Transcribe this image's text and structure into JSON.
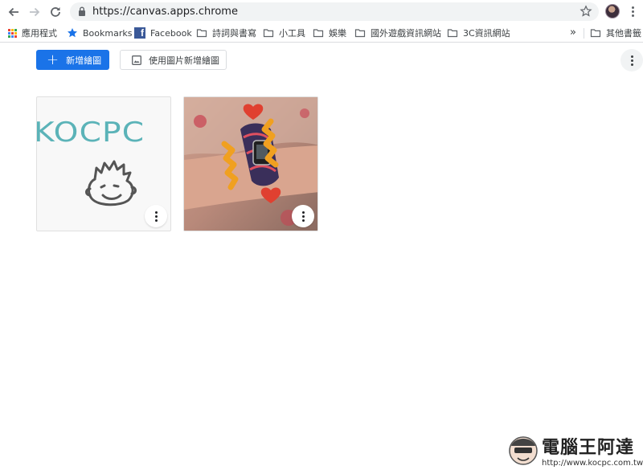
{
  "browser": {
    "url": "https://canvas.apps.chrome",
    "bookmarks": [
      {
        "label": "應用程式",
        "icon": "apps-grid-icon"
      },
      {
        "label": "Bookmarks",
        "icon": "star-icon"
      },
      {
        "label": "Facebook",
        "icon": "facebook-icon"
      },
      {
        "label": "詩詞與書寫",
        "icon": "folder-icon"
      },
      {
        "label": "小工具",
        "icon": "folder-icon"
      },
      {
        "label": "娛樂",
        "icon": "folder-icon"
      },
      {
        "label": "國外遊戲資訊網站",
        "icon": "folder-icon"
      },
      {
        "label": "3C資訊網站",
        "icon": "folder-icon"
      }
    ],
    "overflow_label": "»",
    "other_bookmarks": "其他書籤"
  },
  "toolbar": {
    "new_drawing_label": "新增繪圖",
    "new_from_image_label": "使用圖片新增繪圖"
  },
  "drawings": [
    {
      "name": "kocpc-mascot-drawing",
      "text": "KOCPC"
    },
    {
      "name": "watch-photo-drawing"
    }
  ],
  "watermark": {
    "title": "電腦王阿達",
    "url": "http://www.kocpc.com.tw"
  },
  "colors": {
    "accent": "#1a73e8",
    "kocpc_teal": "#5bb3b8",
    "doodle_orange": "#f0a020",
    "doodle_red": "#e04030"
  }
}
